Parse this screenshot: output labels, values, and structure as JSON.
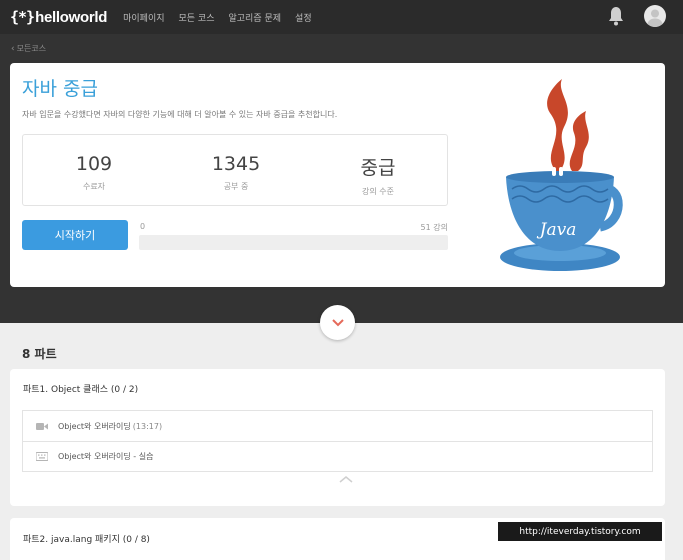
{
  "header": {
    "logo_mark": "{*}",
    "logo_text": "helloworld",
    "nav": [
      "마이페이지",
      "모든 코스",
      "알고리즘 문제",
      "설정"
    ],
    "icons": [
      "bell-icon",
      "user-avatar-icon"
    ]
  },
  "breadcrumb": {
    "label": "모든코스"
  },
  "course": {
    "title": "자바 중급",
    "description": "자바 입문을 수강했다면 자바의 다양한 기능에 대해 더 알아볼 수 있는 자바 중급을 추천합니다.",
    "stats": [
      {
        "value": "109",
        "label": "수료자"
      },
      {
        "value": "1345",
        "label": "공부 중"
      },
      {
        "value": "중급",
        "label": "강의 수준"
      }
    ],
    "start_button": "시작하기",
    "progress": {
      "current_label": "0",
      "total_label": "51 강의",
      "fraction": 0
    },
    "art_text": "Java",
    "colors": {
      "accent": "#3b9be0",
      "title": "#3aa0d9",
      "cup": "#4a90cc",
      "steam": "#c8472a"
    }
  },
  "parts": {
    "count_label": "8 파트",
    "items": [
      {
        "title": "파트1. Object 클래스 (0 / 2)",
        "lessons": [
          {
            "icon": "video-icon",
            "title": "Object와 오버라이딩",
            "meta": "(13:17)"
          },
          {
            "icon": "keyboard-icon",
            "title": "Object와 오버라이딩 - 실습",
            "meta": ""
          }
        ]
      },
      {
        "title": "파트2. java.lang 패키지 (0 / 8)"
      }
    ]
  },
  "watermark": "http://iteverday.tistory.com"
}
